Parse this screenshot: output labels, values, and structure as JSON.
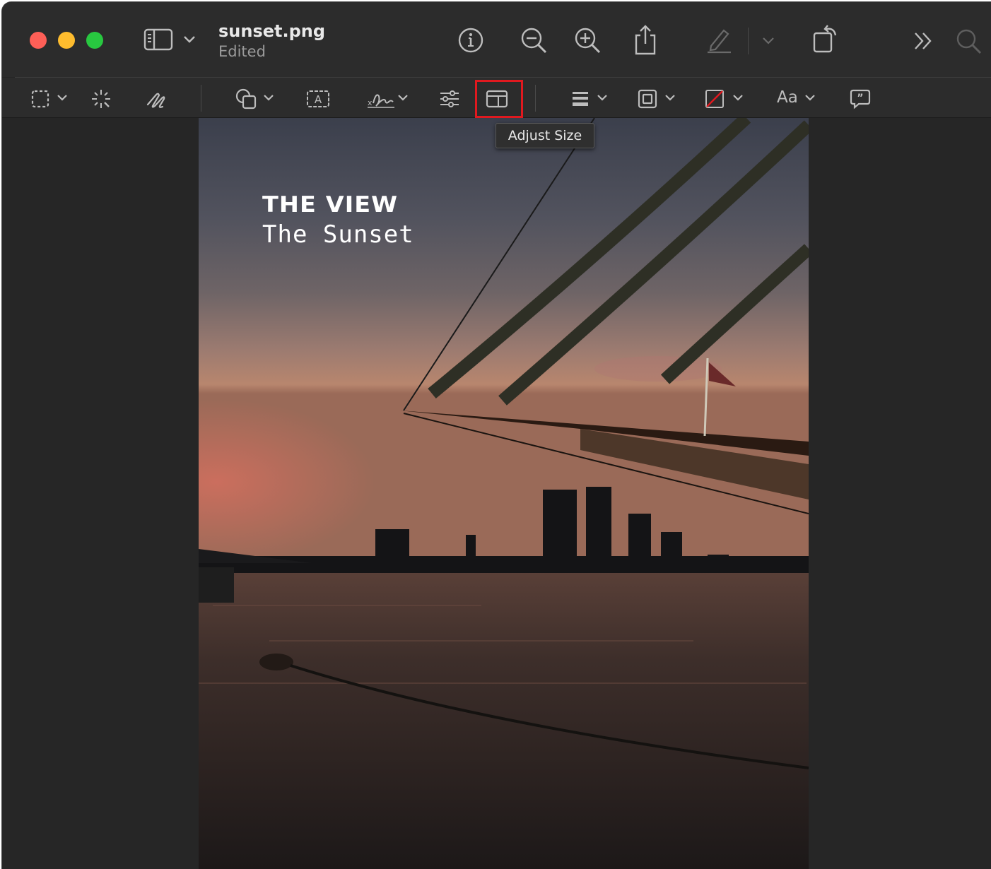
{
  "window": {
    "title": "sunset.png",
    "subtitle": "Edited"
  },
  "titlebar_icons": [
    "sidebar-icon",
    "chevron-down-icon",
    "info-icon",
    "zoom-out-icon",
    "zoom-in-icon",
    "share-icon",
    "markup-pen-icon",
    "chevron-down-icon",
    "rotate-icon",
    "more-icon",
    "search-icon"
  ],
  "toolbar": {
    "text_style_label": "Aa",
    "tools": [
      "selection-icon",
      "instant-alpha-icon",
      "sketch-icon",
      "shapes-icon",
      "text-box-icon",
      "signature-icon",
      "adjust-color-icon",
      "adjust-size-icon",
      "line-style-icon",
      "border-color-icon",
      "fill-color-icon",
      "text-style-icon",
      "note-icon"
    ]
  },
  "tooltip": {
    "text": "Adjust Size"
  },
  "image": {
    "heading": "THE VIEW",
    "subheading": "The Sunset"
  },
  "colors": {
    "highlight": "#e0191f",
    "traffic_red": "#fe5f57",
    "traffic_yellow": "#febc2e",
    "traffic_green": "#28c840"
  }
}
